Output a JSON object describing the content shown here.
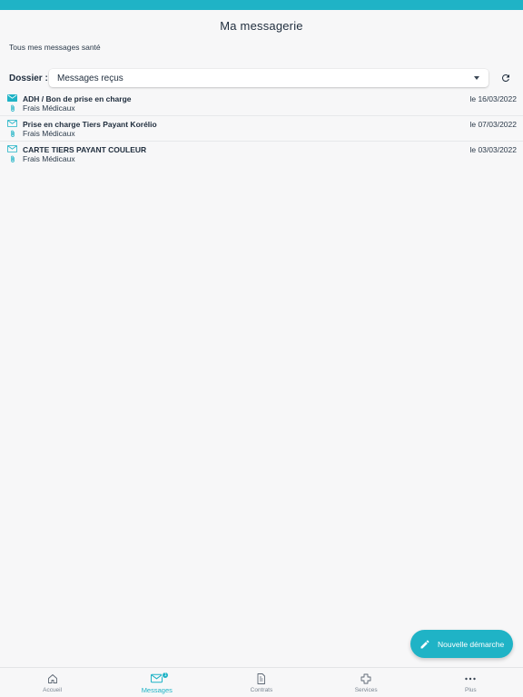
{
  "header": {
    "title": "Ma messagerie"
  },
  "subtitle": "Tous mes messages santé",
  "folder": {
    "label": "Dossier :",
    "selected": "Messages reçus"
  },
  "messages": [
    {
      "subject": "ADH / Bon de prise en charge",
      "category": "Frais Médicaux",
      "date": "le 16/03/2022",
      "unread": true,
      "attachment": true
    },
    {
      "subject": "Prise en charge Tiers Payant Korélio",
      "category": "Frais Médicaux",
      "date": "le 07/03/2022",
      "unread": false,
      "attachment": true
    },
    {
      "subject": "CARTE TIERS PAYANT COULEUR",
      "category": "Frais Médicaux",
      "date": "le 03/03/2022",
      "unread": false,
      "attachment": true
    }
  ],
  "fab": {
    "label": "Nouvelle démarche"
  },
  "tabs": [
    {
      "label": "Accueil",
      "icon": "home-icon"
    },
    {
      "label": "Messages",
      "icon": "mail-icon",
      "active": true,
      "badge": "1"
    },
    {
      "label": "Contrats",
      "icon": "document-icon"
    },
    {
      "label": "Services",
      "icon": "medical-cross-icon"
    },
    {
      "label": "Plus",
      "icon": "more-icon"
    }
  ],
  "colors": {
    "accent": "#1fb3c6",
    "text": "#1f2d3d",
    "background": "#f7f7f8"
  }
}
